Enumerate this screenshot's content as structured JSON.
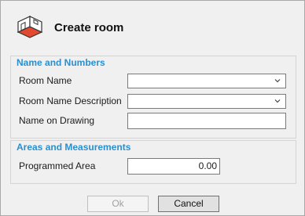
{
  "dialog": {
    "title": "Create room",
    "logo_icon": "room-cube-icon"
  },
  "groups": {
    "names": {
      "title": "Name and Numbers",
      "room_name_label": "Room Name",
      "room_name_value": "",
      "room_desc_label": "Room Name Description",
      "room_desc_value": "",
      "drawing_name_label": "Name on Drawing",
      "drawing_name_value": ""
    },
    "areas": {
      "title": "Areas and Measurements",
      "programmed_area_label": "Programmed Area",
      "programmed_area_value": "0.00"
    }
  },
  "buttons": {
    "ok_label": "Ok",
    "cancel_label": "Cancel"
  },
  "colors": {
    "group_title": "#2a8fd0",
    "logo_red": "#e2492f"
  }
}
